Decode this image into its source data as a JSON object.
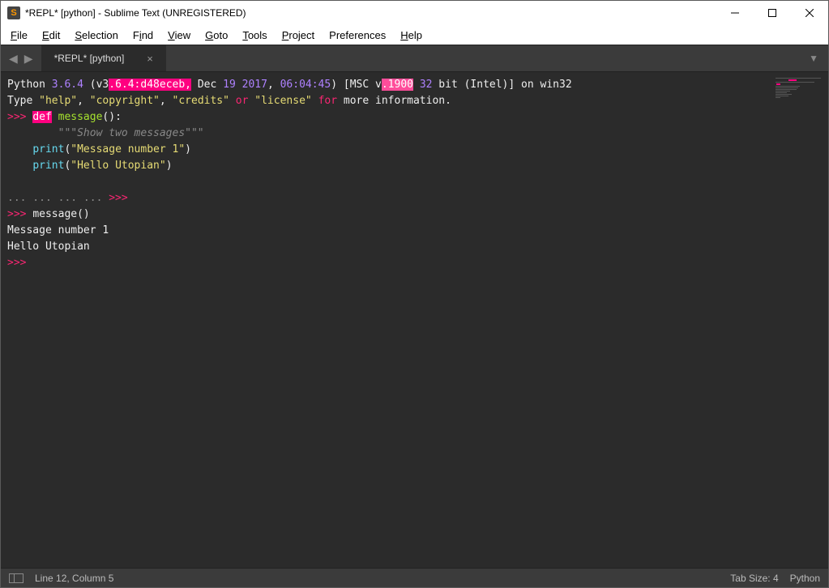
{
  "window": {
    "title": "*REPL* [python] - Sublime Text (UNREGISTERED)"
  },
  "menu": [
    "File",
    "Edit",
    "Selection",
    "Find",
    "View",
    "Goto",
    "Tools",
    "Project",
    "Preferences",
    "Help"
  ],
  "tab": {
    "label": "*REPL* [python]"
  },
  "repl": {
    "l1": {
      "a": "Python ",
      "b": "3.6.4",
      "c": " (v3",
      "hl1": ".6.4:d48eceb,",
      "d": " Dec ",
      "n1": "19",
      "e": " ",
      "n2": "2017",
      "f": ", ",
      "t": "06:04:45",
      "g": ") [MSC v",
      "hl2": ".1900",
      "h": " ",
      "n3": "32",
      "i": " bit (Intel)] on win32"
    },
    "l2": {
      "a": "Type ",
      "s1": "\"help\"",
      "b": ", ",
      "s2": "\"copyright\"",
      "c": ", ",
      "s3": "\"credits\"",
      "d": " ",
      "kw": "or",
      "e": " ",
      "s4": "\"license\"",
      "f": " ",
      "kw2": "for",
      "g": " more information."
    },
    "prompt": ">>> ",
    "l3": {
      "kw": "def",
      "sp": " ",
      "nm": "message",
      "paren": "():"
    },
    "indent": "    ",
    "doc": "\"\"\"Show two messages\"\"\"",
    "p1a": "print",
    "p1b": "(",
    "p1s": "\"Message number 1\"",
    "p1c": ")",
    "p2a": "print",
    "p2b": "(",
    "p2s": "\"Hello Utopian\"",
    "p2c": ")",
    "cont": "... ... ... ... ",
    "cont_prompt": ">>>",
    "call": {
      "nm": "message",
      "p": "()"
    },
    "out1": "Message number 1",
    "out2": "Hello Utopian",
    "final": ">>> "
  },
  "status": {
    "position": "Line 12, Column 5",
    "tab": "Tab Size: 4",
    "lang": "Python"
  }
}
